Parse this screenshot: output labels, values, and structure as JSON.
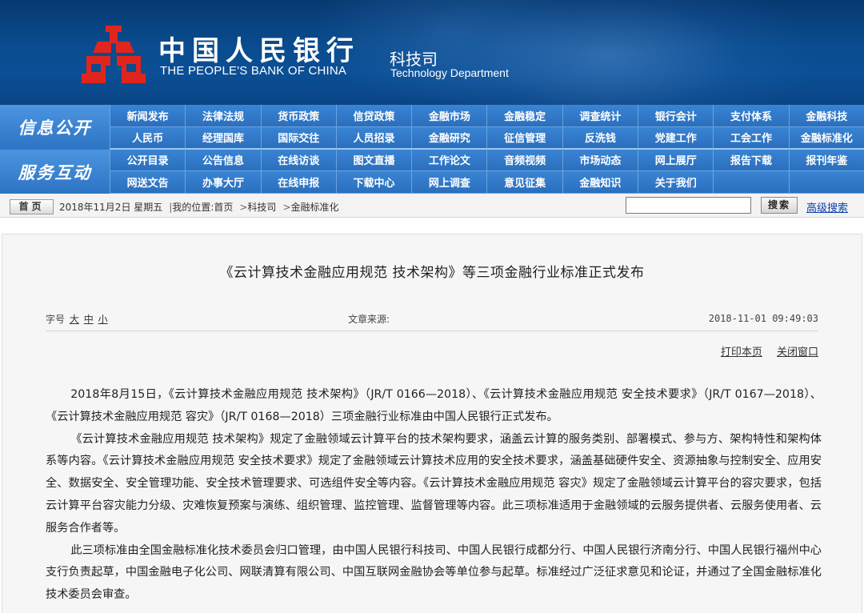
{
  "header": {
    "bank_cn": "中国人民银行",
    "bank_en": "THE PEOPLE'S BANK OF CHINA",
    "dept_cn": "科技司",
    "dept_en": "Technology Department"
  },
  "nav": {
    "section1_label": "信息公开",
    "section2_label": "服务互动",
    "rows": [
      [
        "新闻发布",
        "法律法规",
        "货币政策",
        "信贷政策",
        "金融市场",
        "金融稳定",
        "调查统计",
        "银行会计",
        "支付体系",
        "金融科技"
      ],
      [
        "人民币",
        "经理国库",
        "国际交往",
        "人员招录",
        "金融研究",
        "征信管理",
        "反洗钱",
        "党建工作",
        "工会工作",
        "金融标准化"
      ],
      [
        "公开目录",
        "公告信息",
        "在线访谈",
        "图文直播",
        "工作论文",
        "音频视频",
        "市场动态",
        "网上展厅",
        "报告下载",
        "报刊年鉴"
      ],
      [
        "网送文告",
        "办事大厅",
        "在线申报",
        "下载中心",
        "网上调查",
        "意见征集",
        "金融知识",
        "关于我们",
        "",
        ""
      ]
    ]
  },
  "breadcrumb": {
    "home_label": "首页",
    "date": "2018年11月2日 星期五",
    "location_label": "我的位置:首页",
    "crumb2": "科技司",
    "crumb3": "金融标准化",
    "search_button": "搜索",
    "advanced_search": "高级搜索"
  },
  "article": {
    "title": "《云计算技术金融应用规范 技术架构》等三项金融行业标准正式发布",
    "font_size_label": "字号",
    "size_large": "大",
    "size_medium": "中",
    "size_small": "小",
    "source_label": "文章来源:",
    "datetime": "2018-11-01 09:49:03",
    "print_label": "打印本页",
    "close_label": "关闭窗口",
    "paragraphs": [
      "2018年8月15日，《云计算技术金融应用规范 技术架构》（JR/T 0166—2018）、《云计算技术金融应用规范 安全技术要求》（JR/T 0167—2018）、《云计算技术金融应用规范 容灾》（JR/T 0168—2018）三项金融行业标准由中国人民银行正式发布。",
      "《云计算技术金融应用规范 技术架构》规定了金融领域云计算平台的技术架构要求，涵盖云计算的服务类别、部署模式、参与方、架构特性和架构体系等内容。《云计算技术金融应用规范 安全技术要求》规定了金融领域云计算技术应用的安全技术要求，涵盖基础硬件安全、资源抽象与控制安全、应用安全、数据安全、安全管理功能、安全技术管理要求、可选组件安全等内容。《云计算技术金融应用规范 容灾》规定了金融领域云计算平台的容灾要求，包括云计算平台容灾能力分级、灾难恢复预案与演练、组织管理、监控管理、监督管理等内容。此三项标准适用于金融领域的云服务提供者、云服务使用者、云服务合作者等。",
      "此三项标准由全国金融标准化技术委员会归口管理，由中国人民银行科技司、中国人民银行成都分行、中国人民银行济南分行、中国人民银行福州中心支行负责起草，中国金融电子化公司、网联清算有限公司、中国互联网金融协会等单位参与起草。标准经过广泛征求意见和论证，并通过了全国金融标准化技术委员会审查。"
    ]
  },
  "colors": {
    "banner": "#0a4c8f",
    "nav": "#2f78c9",
    "logo_red": "#e0261c",
    "link": "#0b3fa8"
  }
}
